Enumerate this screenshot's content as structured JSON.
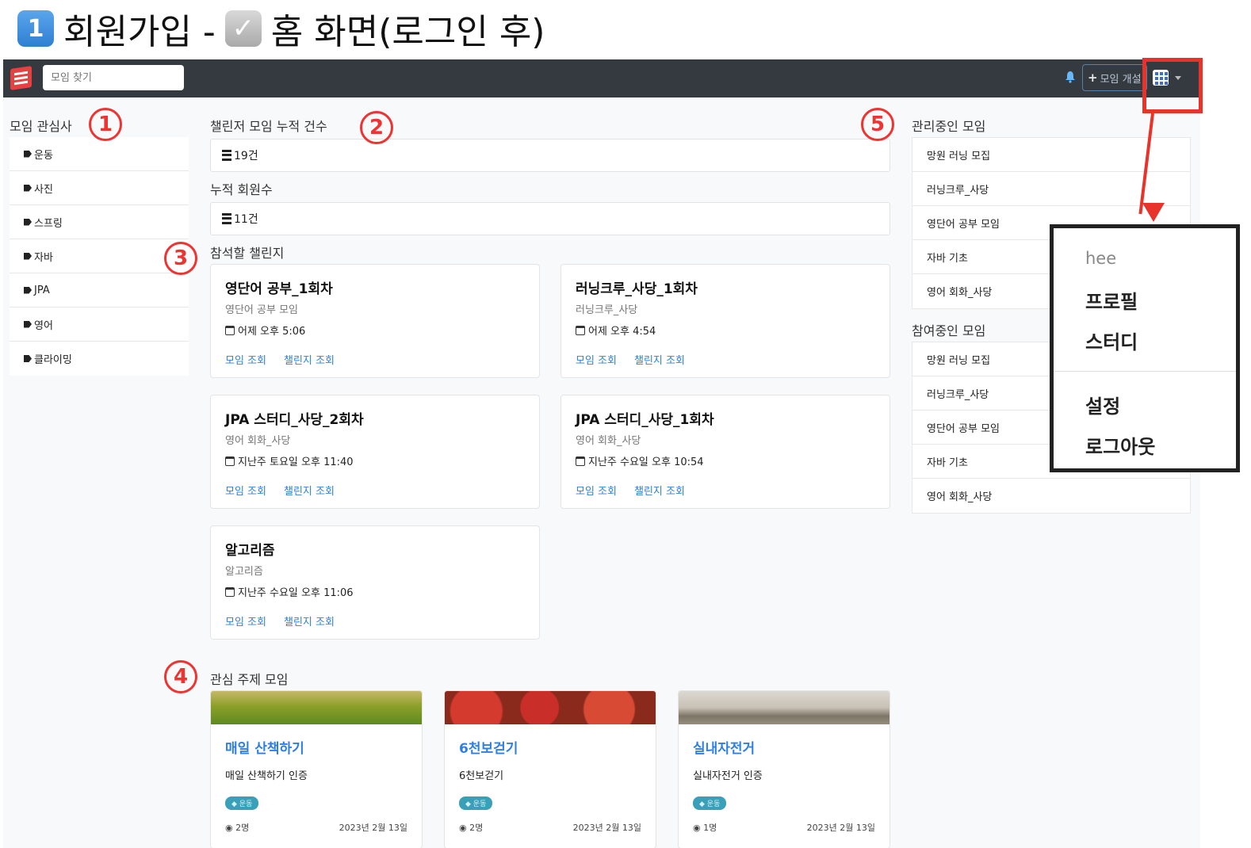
{
  "doc_title": {
    "num_badge": "1",
    "text_before": "회원가입 -",
    "check_badge": "✓",
    "text_after": "홈 화면(로그인 후)"
  },
  "navbar": {
    "search_placeholder": "모임 찾기",
    "create_button": "모임 개설",
    "create_icon": "plus-icon",
    "bell_icon": "bell-icon",
    "profile_icon": "grid-avatar-icon"
  },
  "callouts": {
    "c1": "1",
    "c2": "2",
    "c3": "3",
    "c4": "4",
    "c5": "5"
  },
  "interests": {
    "title": "모임 관심사",
    "items": [
      "운동",
      "사진",
      "스프링",
      "자바",
      "JPA",
      "영어",
      "클라이밍"
    ]
  },
  "stats": {
    "challenge_title": "챌린저 모임 누적 건수",
    "challenge_count": "19건",
    "member_title": "누적 회원수",
    "member_count": "11건"
  },
  "challenges": {
    "title": "참석할 챌린지",
    "cards": [
      {
        "title": "영단어 공부_1회차",
        "group": "영단어 공부 모임",
        "time": "어제 오후 5:06",
        "link1": "모임 조회",
        "link2": "챌린지 조회"
      },
      {
        "title": "러닝크루_사당_1회차",
        "group": "러닝크루_사당",
        "time": "어제 오후 4:54",
        "link1": "모임 조회",
        "link2": "챌린지 조회"
      },
      {
        "title": "JPA 스터디_사당_2회차",
        "group": "영어 회화_사당",
        "time": "지난주 토요일 오후 11:40",
        "link1": "모임 조회",
        "link2": "챌린지 조회"
      },
      {
        "title": "JPA 스터디_사당_1회차",
        "group": "영어 회화_사당",
        "time": "지난주 수요일 오후 10:54",
        "link1": "모임 조회",
        "link2": "챌린지 조회"
      },
      {
        "title": "알고리즘",
        "group": "알고리즘",
        "time": "지난주 수요일 오후 11:06",
        "link1": "모임 조회",
        "link2": "챌린지 조회"
      }
    ]
  },
  "interest_groups": {
    "title": "관심 주제 모임",
    "cards": [
      {
        "title": "매일 산책하기",
        "desc": "매일 산책하기 인증",
        "tag": "운동",
        "members": "2명",
        "date": "2023년 2월 13일"
      },
      {
        "title": "6천보걷기",
        "desc": "6천보걷기",
        "tag": "운동",
        "members": "2명",
        "date": "2023년 2월 13일"
      },
      {
        "title": "실내자전거",
        "desc": "실내자전거 인증",
        "tag": "운동",
        "members": "1명",
        "date": "2023년 2월 13일"
      }
    ]
  },
  "managed": {
    "title": "관리중인 모임",
    "items": [
      "망원 러닝 모집",
      "러닝크루_사당",
      "영단어 공부 모임",
      "자바 기초",
      "영어 회화_사당"
    ]
  },
  "joined": {
    "title": "참여중인 모임",
    "items": [
      "망원 러닝 모집",
      "러닝크루_사당",
      "영단어 공부 모임",
      "자바 기초",
      "영어 회화_사당"
    ]
  },
  "dropdown": {
    "user": "hee",
    "profile": "프로필",
    "study": "스터디",
    "settings": "설정",
    "logout": "로그아웃"
  },
  "colors": {
    "navbar": "#343a40",
    "link": "#2f7fe0",
    "callout": "#e8332a",
    "tag_badge": "#3aa0b8"
  }
}
